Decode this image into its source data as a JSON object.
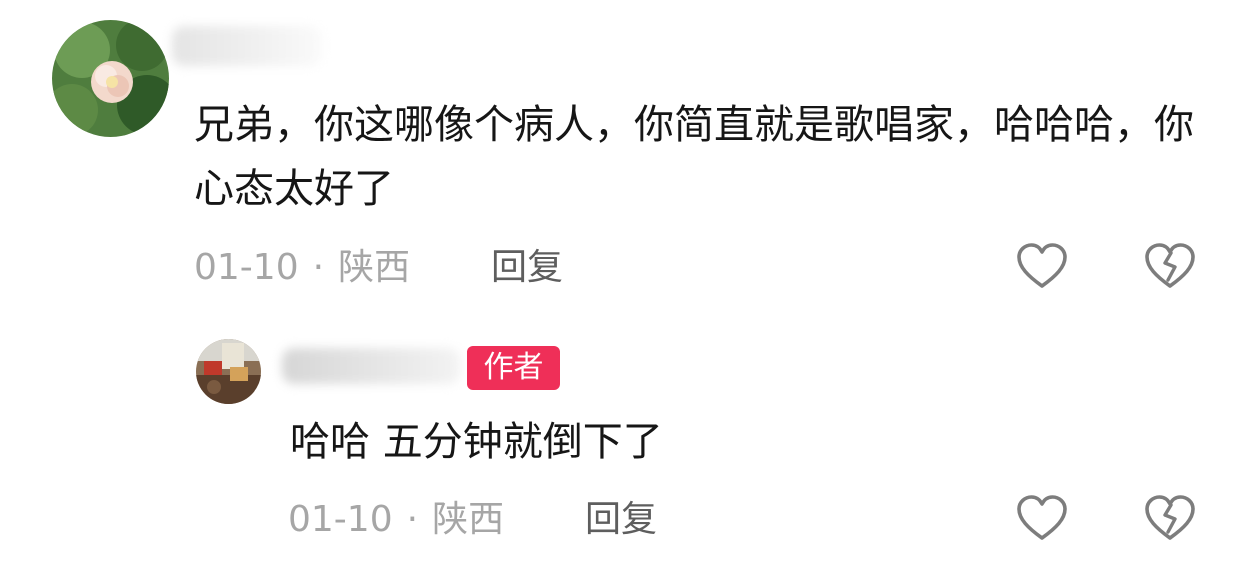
{
  "comments": [
    {
      "text": "兄弟，你这哪像个病人，你简直就是歌唱家，哈哈哈，你心态太好了",
      "date": "01-10",
      "separator": "·",
      "location": "陕西",
      "reply_label": "回复",
      "icons": {
        "like": "heart-outline-icon",
        "dislike": "broken-heart-outline-icon"
      }
    }
  ],
  "replies": [
    {
      "badge": "作者",
      "text": "哈哈 五分钟就倒下了",
      "date": "01-10",
      "separator": "·",
      "location": "陕西",
      "reply_label": "回复",
      "icons": {
        "like": "heart-outline-icon",
        "dislike": "broken-heart-outline-icon"
      }
    }
  ],
  "colors": {
    "badge": "#ef2f58",
    "meta": "#a6a6a6",
    "text": "#161616",
    "reply": "#5e5e5e"
  }
}
